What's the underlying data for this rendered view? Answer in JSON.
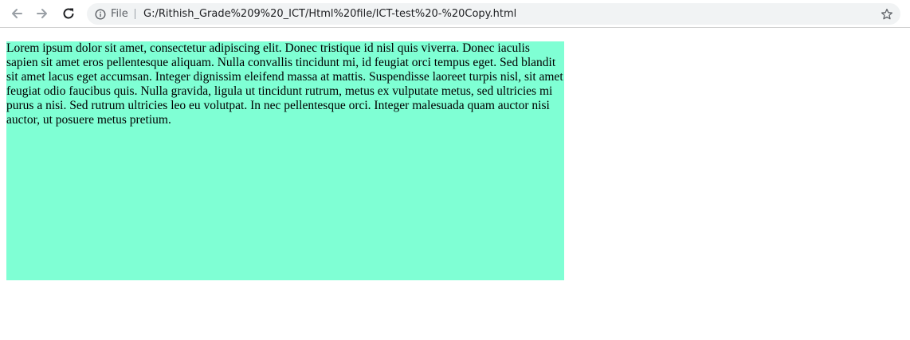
{
  "browser": {
    "scheme_label": "File",
    "url": "G:/Rithish_Grade%209%20_ICT/Html%20file/ICT-test%20-%20Copy.html",
    "icons": {
      "back": "arrow-left",
      "forward": "arrow-right",
      "reload": "reload",
      "site_info": "info-circle",
      "bookmark": "star-outline"
    }
  },
  "page": {
    "paragraph": "Lorem ipsum dolor sit amet, consectetur adipiscing elit. Donec tristique id nisl quis viverra. Donec iaculis sapien sit amet eros pellentesque aliquam. Nulla convallis tincidunt mi, id feugiat orci tempus eget. Sed blandit sit amet lacus eget accumsan. Integer dignissim eleifend massa at mattis. Suspendisse laoreet turpis nisl, sit amet feugiat odio faucibus quis. Nulla gravida, ligula ut tincidunt rutrum, metus ex vulputate metus, sed ultricies mi purus a nisi. Sed rutrum ultricies leo eu volutpat. In nec pellentesque orci. Integer malesuada quam auctor nisi auctor, ut posuere metus pretium.",
    "box_color": "#7fffd4"
  }
}
